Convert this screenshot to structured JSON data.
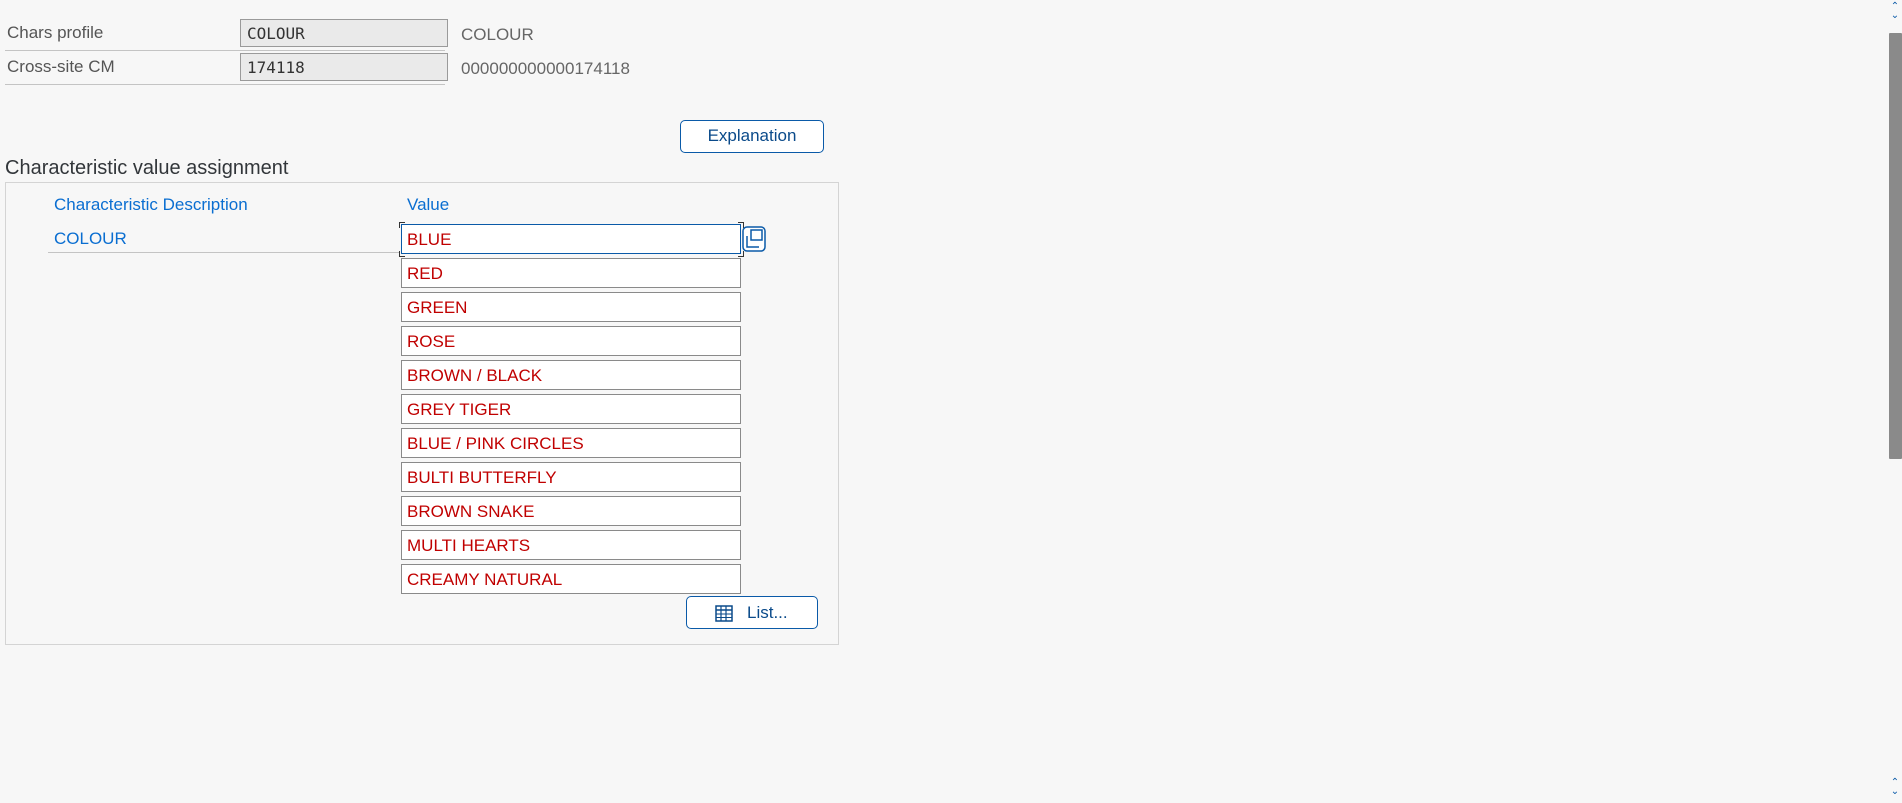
{
  "header": {
    "chars_profile_label": "Chars profile",
    "chars_profile_value": "COLOUR",
    "chars_profile_desc": "COLOUR",
    "cross_site_label": "Cross-site CM",
    "cross_site_value": "174118",
    "cross_site_desc": "000000000000174118"
  },
  "buttons": {
    "explanation": "Explanation",
    "list": "List..."
  },
  "section": {
    "title": "Characteristic value assignment",
    "col_description": "Characteristic Description",
    "col_value": "Value",
    "characteristic": "COLOUR"
  },
  "values": [
    "BLUE",
    "RED",
    "GREEN",
    "ROSE",
    "BROWN / BLACK",
    "GREY TIGER",
    "BLUE / PINK CIRCLES",
    "BULTI BUTTERFLY",
    "BROWN SNAKE",
    "MULTI HEARTS",
    "CREAMY NATURAL"
  ],
  "colors": {
    "value_text": "#c00000",
    "link_blue": "#0a6ed1",
    "button_border": "#0a5aa8"
  },
  "icons": {
    "multi_select": "multi-selection-icon",
    "list": "table-list-icon",
    "scroll_up": "chevron-up-icon",
    "scroll_down": "chevron-down-icon"
  }
}
